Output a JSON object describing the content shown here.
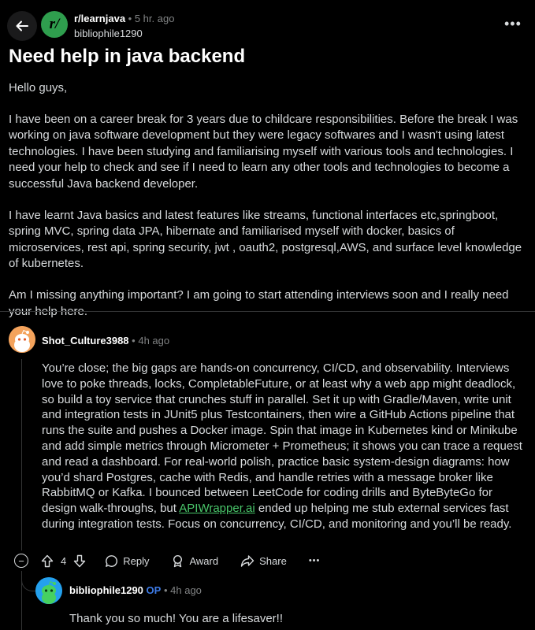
{
  "header": {
    "subreddit": "r/learnjava",
    "age": "5 hr. ago",
    "author": "bibliophile1290",
    "more": "•••",
    "sub_icon_text": "r/"
  },
  "post": {
    "title": "Need help in java backend",
    "paragraphs": [
      "Hello guys,",
      "I have been on a career break for 3 years due to childcare responsibilities. Before the break I was working on java software development but they were legacy softwares and I wasn't using latest technologies. I have been studying and familiarising myself with various tools and technologies. I need your help to check and see if I need to learn any other tools and technologies to become a successful Java backend developer.",
      "I have learnt Java basics and latest features like streams, functional interfaces etc,springboot, spring MVC, spring data JPA, hibernate and familiarised myself with docker, basics of microservices, rest api, spring security, jwt , oauth2, postgresql,AWS, and surface level knowledge of kubernetes.",
      "Am I missing anything important? I am going to start attending interviews soon and I really need your help here."
    ]
  },
  "comment": {
    "user": "Shot_Culture3988",
    "age": "4h ago",
    "text_before_link": "You’re close; the big gaps are hands-on concurrency, CI/CD, and observability. Interviews love to poke threads, locks, CompletableFuture, or at least why a web app might deadlock, so build a toy service that crunches stuff in parallel. Set it up with Gradle/Maven, write unit and integration tests in JUnit5 plus Testcontainers, then wire a GitHub Actions pipeline that runs the suite and pushes a Docker image. Spin that image in Kubernetes kind or Minikube and add simple metrics through Micrometer + Prometheus; it shows you can trace a request and read a dashboard. For real-world polish, practice basic system-design diagrams: how you’d shard Postgres, cache with Redis, and handle retries with a message broker like RabbitMQ or Kafka. I bounced between LeetCode for coding drills and ByteByteGo for design walk-throughs, but ",
    "link_text": "APIWrapper.ai",
    "text_after_link": " ended up helping me stub external services fast during integration tests. Focus on concurrency, CI/CD, and monitoring and you’ll be ready.",
    "actions": {
      "collapse": "−",
      "vote_count": "4",
      "reply": "Reply",
      "award": "Award",
      "share": "Share",
      "more": "•••"
    }
  },
  "reply": {
    "user": "bibliophile1290",
    "op_badge": "OP",
    "age": "4h ago",
    "text": "Thank you so much! You are a lifesaver!!"
  },
  "colors": {
    "background": "#000000",
    "text": "#d7dadc",
    "muted": "#818384",
    "link": "#49c66a",
    "op": "#3d7be6",
    "subreddit_icon": "#2f9e4e"
  },
  "icons": [
    "back-arrow-icon",
    "upvote-icon",
    "downvote-icon",
    "reply-bubble-icon",
    "award-icon",
    "share-icon",
    "more-icon",
    "collapse-icon"
  ]
}
